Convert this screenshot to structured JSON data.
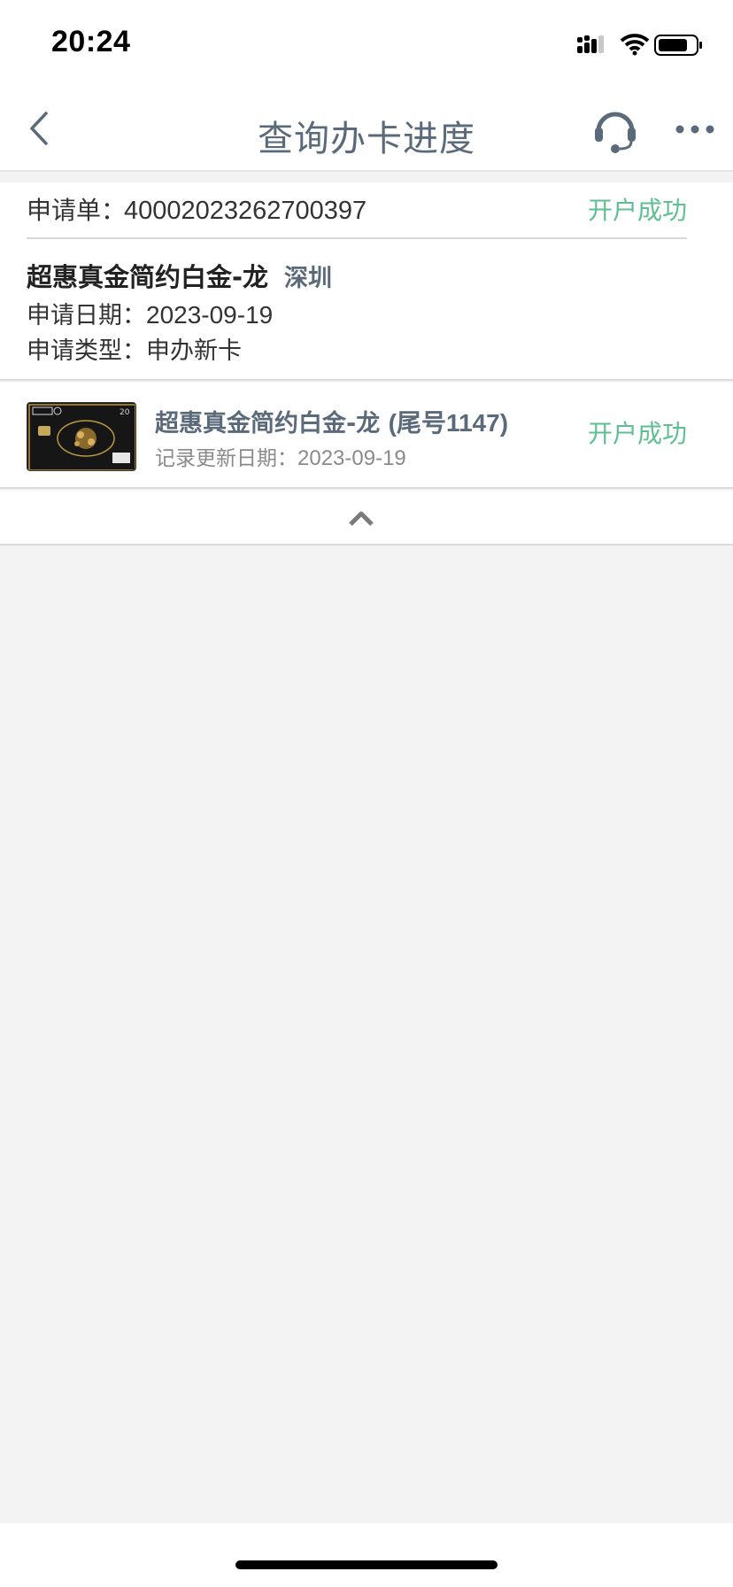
{
  "status_bar": {
    "time": "20:24"
  },
  "nav": {
    "title": "查询办卡进度",
    "back_icon": "chevron-left-icon",
    "service_icon": "headset-icon",
    "more_icon": "more-dots-icon"
  },
  "application": {
    "number_label": "申请单：",
    "number_value": "40002023262700397",
    "status": "开户成功",
    "product_name": "超惠真金简约白金-龙",
    "city": "深圳",
    "date_label": "申请日期：",
    "date_value": "2023-09-19",
    "type_label": "申请类型：",
    "type_value": "申办新卡"
  },
  "card_record": {
    "title": "超惠真金简约白金-龙",
    "suffix": "(尾号1147)",
    "update_label": "记录更新日期：",
    "update_value": "2023-09-19",
    "status": "开户成功"
  },
  "colors": {
    "success": "#5fbf92",
    "title_gray": "#5a6a7a",
    "background": "#f3f3f4"
  }
}
